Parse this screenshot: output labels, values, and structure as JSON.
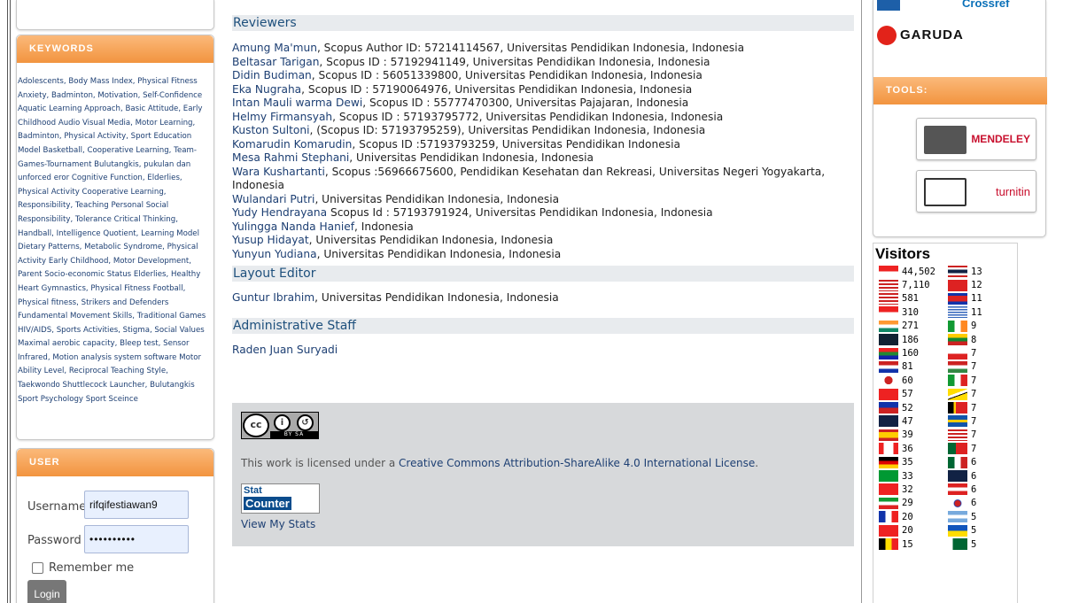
{
  "sidebar": {
    "keywords_heading": "KEYWORDS",
    "keywords": [
      "Adolescents, Body Mass Index, Physical Fitness Anxiety, Badminton, Motivation, Self-Confidence Aquatic Learning Approach, Basic Attitude, Early Childhood Audio Visual Media, Motor Learning, Badminton, Physical Activity, Sport Education Model Basketball, Cooperative Learning, Team-Games-Tournament Bulutangkis, pukulan dan unforced eror Cognitive Function, Elderlies, Physical Activity Cooperative Learning, Responsibility, Teaching Personal Social Responsibility, Tolerance Critical Thinking, Handball, Intelligence Quotient, Learning Model Dietary Patterns, Metabolic Syndrome, Physical Activity Early Childhood, Motor Development, Parent Socio-economic Status Elderlies, Healthy Heart Gymnastics, Physical Fitness Football, Physical fitness, Strikers and Defenders Fundamental Movement Skills, Traditional Games HIV/AIDS, Sports Activities, Stigma, Social Values Maximal aerobic capacity, Bleep test, Sensor Infrared, Motion analysis system software Motor Ability Level, Reciprocal Teaching Style, Taekwondo Shuttlecock Launcher, Bulutangkis Sport Psychology Sport Sceince"
    ],
    "user_heading": "USER",
    "username_label": "Username",
    "username_value": "rifqifestiawan9",
    "password_label": "Password",
    "password_value": "••••••••••",
    "remember_label": "Remember me",
    "login_label": "Login"
  },
  "main": {
    "reviewers_heading": "Reviewers",
    "reviewers": [
      {
        "name": "Amung Ma'mun",
        "rest": ", Scopus Author ID: 57214114567, Universitas Pendidikan Indonesia, Indonesia"
      },
      {
        "name": "Beltasar Tarigan",
        "rest": ", Scopus ID : 57192941149, Universitas Pendidikan Indonesia, Indonesia"
      },
      {
        "name": "Didin Budiman",
        "rest": ", Scopus ID : 56051339800, Universitas Pendidikan Indonesia, Indonesia"
      },
      {
        "name": "Eka Nugraha",
        "rest": ", Scopus ID : 57190064976, Universitas Pendidikan Indonesia, Indonesia"
      },
      {
        "name": "Intan Mauli warma Dewi",
        "rest": ", Scopus ID : 55777470300, Universitas Pajajaran, Indonesia"
      },
      {
        "name": "Helmy Firmansyah",
        "rest": ", Scopus ID : 57193795772, Universitas Pendidikan Indonesia, Indonesia"
      },
      {
        "name": "Kuston Sultoni",
        "rest": ", (Scopus ID: 57193795259), Universitas Pendidikan Indonesia, Indonesia"
      },
      {
        "name": "Komarudin Komarudin",
        "rest": ", Scopus ID :57193793259, Universitas Pendidikan Indonesia"
      },
      {
        "name": "Mesa Rahmi Stephani",
        "rest": ", Universitas Pendidikan Indonesia, Indonesia"
      },
      {
        "name": "Wara Kushartanti",
        "rest": ", Scopus :56966675600, Pendidikan Kesehatan dan Rekreasi, Universitas Negeri Yogyakarta, Indonesia"
      },
      {
        "name": "Wulandari Putri",
        "rest": ", Universitas Pendidikan Indonesia, Indonesia"
      },
      {
        "name": "Yudy Hendrayana",
        "rest": " Scopus Id : 57193791924, Universitas Pendidikan Indonesia, Indonesia"
      },
      {
        "name": "Yulingga Nanda Hanief",
        "rest": ", Indonesia"
      },
      {
        "name": "Yusup Hidayat",
        "rest": ", Universitas Pendidikan Indonesia, Indonesia"
      },
      {
        "name": "Yunyun Yudiana",
        "rest": ", Universitas Pendidikan Indonesia, Indonesia"
      }
    ],
    "layout_heading": "Layout Editor",
    "layout_editor": {
      "name": "Guntur Ibrahim",
      "rest": ", Universitas Pendidikan Indonesia, Indonesia"
    },
    "admin_heading": "Administrative Staff",
    "admin_staff": "Raden Juan Suryadi"
  },
  "footer": {
    "cc_badge_text": "cc",
    "cc_band": "BY  SA",
    "license_prefix": "This work is licensed under a ",
    "license_link": "Creative Commons Attribution-ShareAlike 4.0 International License",
    "license_suffix": ".",
    "statcounter_top": "Stat",
    "statcounter_bottom": "Counter",
    "view_stats": "View My Stats"
  },
  "right": {
    "garuda": "GARUDA",
    "tools_heading": "TOOLS:",
    "mendeley": "MENDELEY",
    "turnitin": "turnitin",
    "visitors_heading": "Visitors",
    "visitors_left": [
      {
        "count": "44,502",
        "flag": "flag-indonesia"
      },
      {
        "count": "7,110",
        "flag": "flag-united-states"
      },
      {
        "count": "581",
        "flag": "flag-malaysia"
      },
      {
        "count": "310",
        "flag": "flag-singapore"
      },
      {
        "count": "271",
        "flag": "flag-india"
      },
      {
        "count": "186",
        "flag": "flag-united-kingdom"
      },
      {
        "count": "160",
        "flag": "flag-south-africa"
      },
      {
        "count": "81",
        "flag": "flag-netherlands"
      },
      {
        "count": "60",
        "flag": "flag-japan"
      },
      {
        "count": "57",
        "flag": "flag-turkey"
      },
      {
        "count": "52",
        "flag": "flag-philippines"
      },
      {
        "count": "47",
        "flag": "flag-australia"
      },
      {
        "count": "39",
        "flag": "flag-spain"
      },
      {
        "count": "36",
        "flag": "flag-canada"
      },
      {
        "count": "35",
        "flag": "flag-germany"
      },
      {
        "count": "33",
        "flag": "flag-brazil"
      },
      {
        "count": "32",
        "flag": "flag-hong-kong"
      },
      {
        "count": "29",
        "flag": "flag-iran"
      },
      {
        "count": "20",
        "flag": "flag-france"
      },
      {
        "count": "20",
        "flag": "flag-china"
      },
      {
        "count": "15",
        "flag": "flag-belgium"
      }
    ],
    "visitors_right": [
      {
        "count": "13",
        "flag": "flag-thailand"
      },
      {
        "count": "12",
        "flag": "flag-vietnam"
      },
      {
        "count": "11",
        "flag": "flag-cambodia"
      },
      {
        "count": "11",
        "flag": "flag-greece"
      },
      {
        "count": "9",
        "flag": "flag-ireland"
      },
      {
        "count": "8",
        "flag": "flag-lithuania"
      },
      {
        "count": "7",
        "flag": "flag-poland"
      },
      {
        "count": "7",
        "flag": "flag-hungary"
      },
      {
        "count": "7",
        "flag": "flag-italy"
      },
      {
        "count": "7",
        "flag": "flag-brunei"
      },
      {
        "count": "7",
        "flag": "flag-timor-leste"
      },
      {
        "count": "7",
        "flag": "flag-sweden"
      },
      {
        "count": "7",
        "flag": "flag-united-states"
      },
      {
        "count": "7",
        "flag": "flag-portugal"
      },
      {
        "count": "6",
        "flag": "flag-mexico"
      },
      {
        "count": "6",
        "flag": "flag-new-zealand"
      },
      {
        "count": "6",
        "flag": "flag-austria"
      },
      {
        "count": "6",
        "flag": "flag-south-korea"
      },
      {
        "count": "5",
        "flag": "flag-argentina"
      },
      {
        "count": "5",
        "flag": "flag-ukraine"
      },
      {
        "count": "5",
        "flag": "flag-pakistan"
      }
    ]
  }
}
